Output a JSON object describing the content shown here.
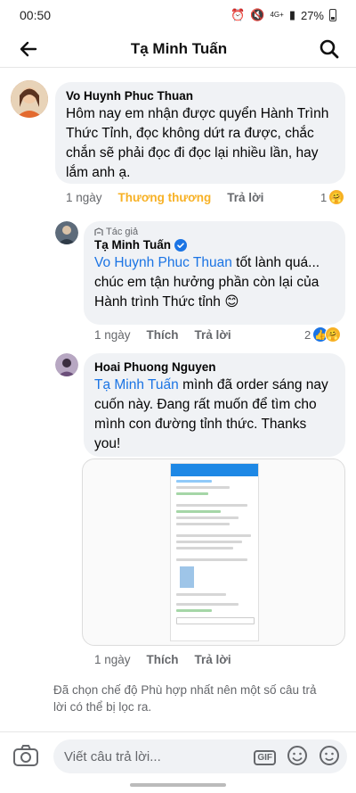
{
  "status": {
    "time": "00:50",
    "network": "4G+",
    "battery": "27%"
  },
  "header": {
    "title": "Tạ Minh Tuấn"
  },
  "comments": [
    {
      "author": "Vo Huynh Phuc Thuan",
      "text": "Hôm nay em nhận được quyển Hành Trình Thức Tỉnh, đọc không dứt ra được, chắc chắn sẽ phải đọc đi đọc lại nhiều lần, hay lắm anh ạ.",
      "time": "1 ngày",
      "reaction_label": "Thương thương",
      "reply_label": "Trả lời",
      "reaction_count": "1"
    },
    {
      "badge": "Tác giả",
      "author": "Tạ Minh Tuấn",
      "mention": "Vo Huynh Phuc Thuan",
      "text": " tốt lành quá... chúc em tận hưởng phần còn lại của Hành trình Thức tỉnh 😊",
      "time": "1 ngày",
      "like_label": "Thích",
      "reply_label": "Trả lời",
      "reaction_count": "2"
    },
    {
      "author": "Hoai Phuong Nguyen",
      "mention": "Tạ Minh Tuấn",
      "text": " mình đã order sáng nay cuốn này. Đang rất muốn để tìm cho mình con đường tỉnh thức. Thanks you!",
      "time": "1 ngày",
      "like_label": "Thích",
      "reply_label": "Trả lời"
    }
  ],
  "filter_note": "Đã chọn chế độ Phù hợp nhất nên một số câu trả lời có thể bị lọc ra.",
  "composer": {
    "placeholder": "Viết câu trả lời...",
    "gif_label": "GIF"
  },
  "colors": {
    "mention": "#1b74e4",
    "reaction": "#f7b125",
    "bubble": "#f0f2f5"
  }
}
